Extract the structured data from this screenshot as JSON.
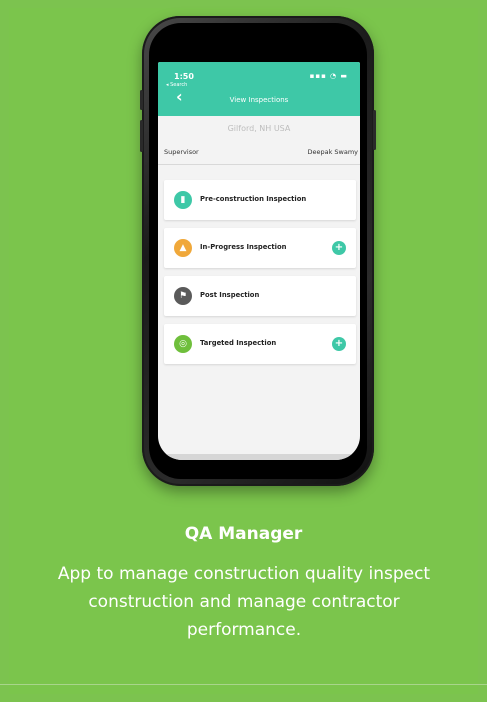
{
  "app": {
    "status_time": "1:50",
    "status_search": "◂ Search",
    "status_icons": "▪▪▪ ◔ ▬",
    "header_title": "View Inspections",
    "back_icon": "‹",
    "location": "Gilford, NH USA",
    "supervisor_label": "Supervisor",
    "supervisor_value": "Deepak Swamy",
    "cards": [
      {
        "label": "Pre-construction Inspection",
        "icon": "phone-icon",
        "glyph": "▮",
        "has_plus": false
      },
      {
        "label": "In-Progress Inspection",
        "icon": "traffic-cone-icon",
        "glyph": "▲",
        "has_plus": true
      },
      {
        "label": "Post Inspection",
        "icon": "checkered-flag-icon",
        "glyph": "⚑",
        "has_plus": false
      },
      {
        "label": "Targeted Inspection",
        "icon": "target-icon",
        "glyph": "◎",
        "has_plus": true
      }
    ],
    "plus_glyph": "+"
  },
  "caption": {
    "title": "QA Manager",
    "desc": "App to manage construction quality inspect construction and manage contractor performance."
  },
  "colors": {
    "background": "#7cc34f",
    "accent": "#3ec8a7"
  }
}
